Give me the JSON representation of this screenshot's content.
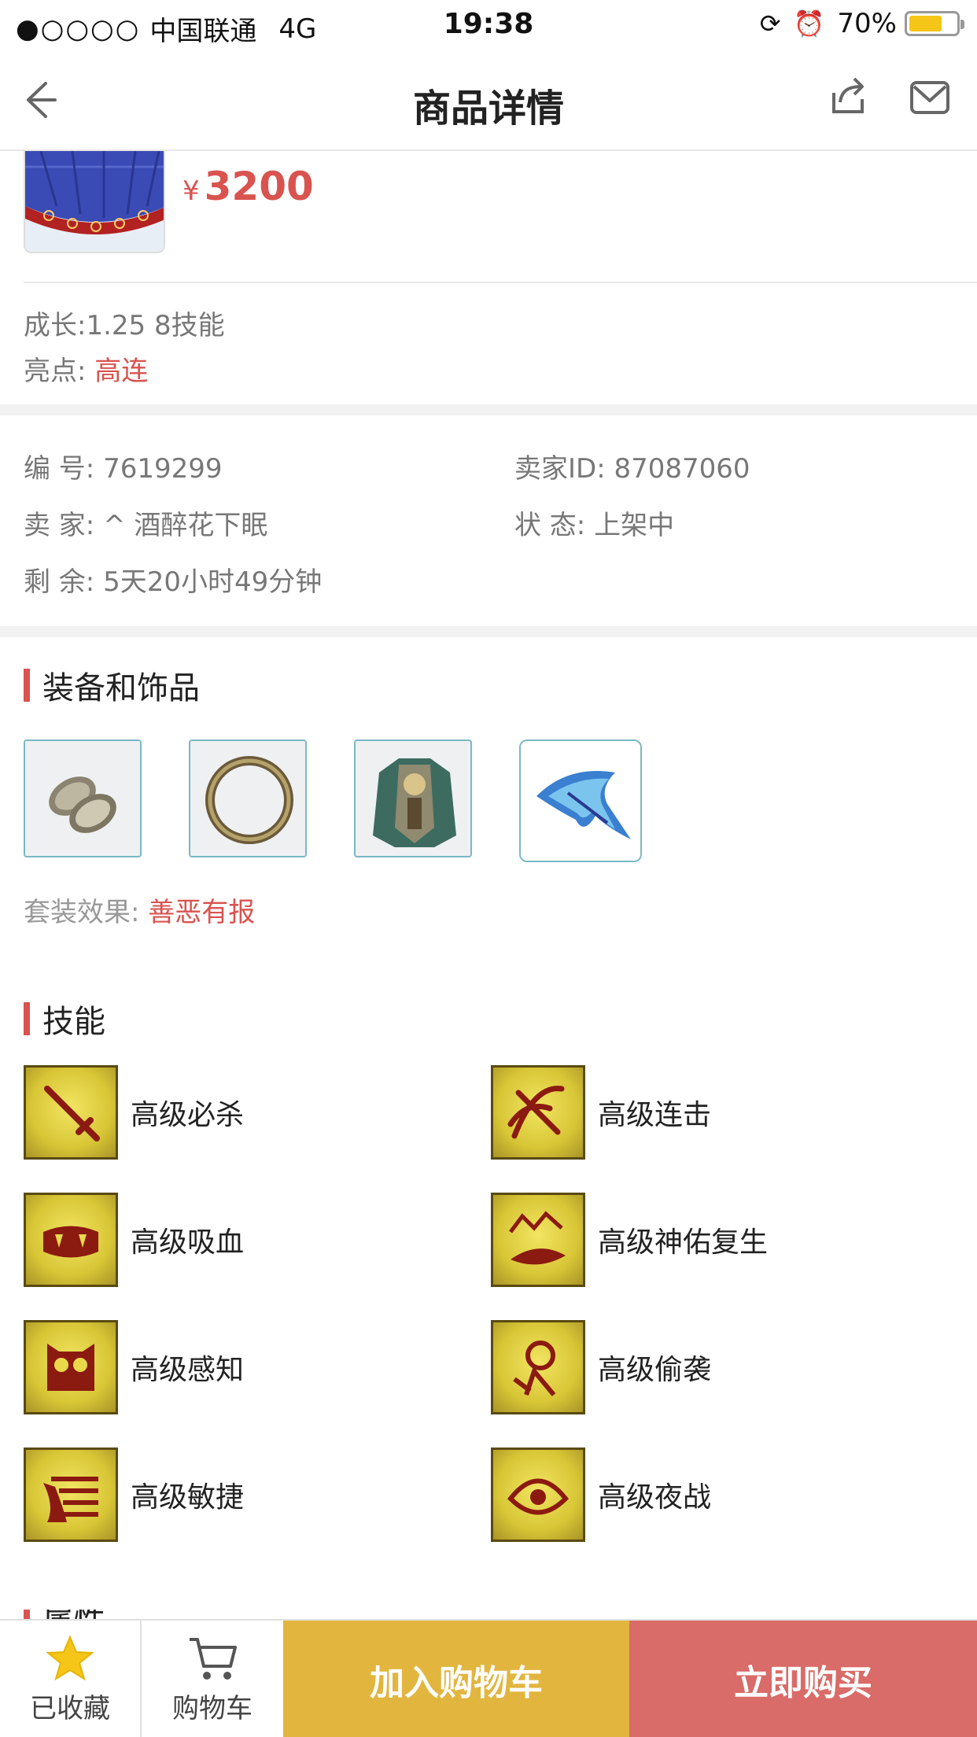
{
  "status_bar": {
    "signal": "●○○○○",
    "carrier": "中国联通",
    "network": "4G",
    "time": "19:38",
    "battery_text": "70%",
    "battery_level": 0.7,
    "battery_color": "#f5c518"
  },
  "nav": {
    "title": "商品详情",
    "back_icon": "back-arrow-icon",
    "share_icon": "share-icon",
    "mail_icon": "mail-icon"
  },
  "product": {
    "currency": "¥",
    "price": "3200",
    "growth": "成长:1.25 8技能",
    "highlight_label": "亮点:",
    "highlight_value": "高连"
  },
  "info": {
    "id_label": "编  号:",
    "id_value": "7619299",
    "seller_id_label": "卖家ID:",
    "seller_id_value": "87087060",
    "seller_label": "卖  家:",
    "seller_value": "^ 酒醉花下眠",
    "status_label": "状  态:",
    "status_value": "上架中",
    "remain_label": "剩  余:",
    "remain_value": "5天20小时49分钟"
  },
  "equipment": {
    "title": "装备和饰品",
    "items": [
      "bracer-icon",
      "ring-icon",
      "armor-icon",
      "wing-icon"
    ],
    "set_label": "套装效果:",
    "set_value": "善恶有报"
  },
  "skills": {
    "title": "技能",
    "items": [
      "高级必杀",
      "高级连击",
      "高级吸血",
      "高级神佑复生",
      "高级感知",
      "高级偷袭",
      "高级敏捷",
      "高级夜战"
    ]
  },
  "next_section_partial": "属性",
  "bottom": {
    "favorite_label": "已收藏",
    "cart_label": "购物车",
    "add_cart": "加入购物车",
    "buy_now": "立即购买",
    "accent_add": "#e2b53e",
    "accent_buy": "#d96b68",
    "accent_price": "#d9534f"
  }
}
